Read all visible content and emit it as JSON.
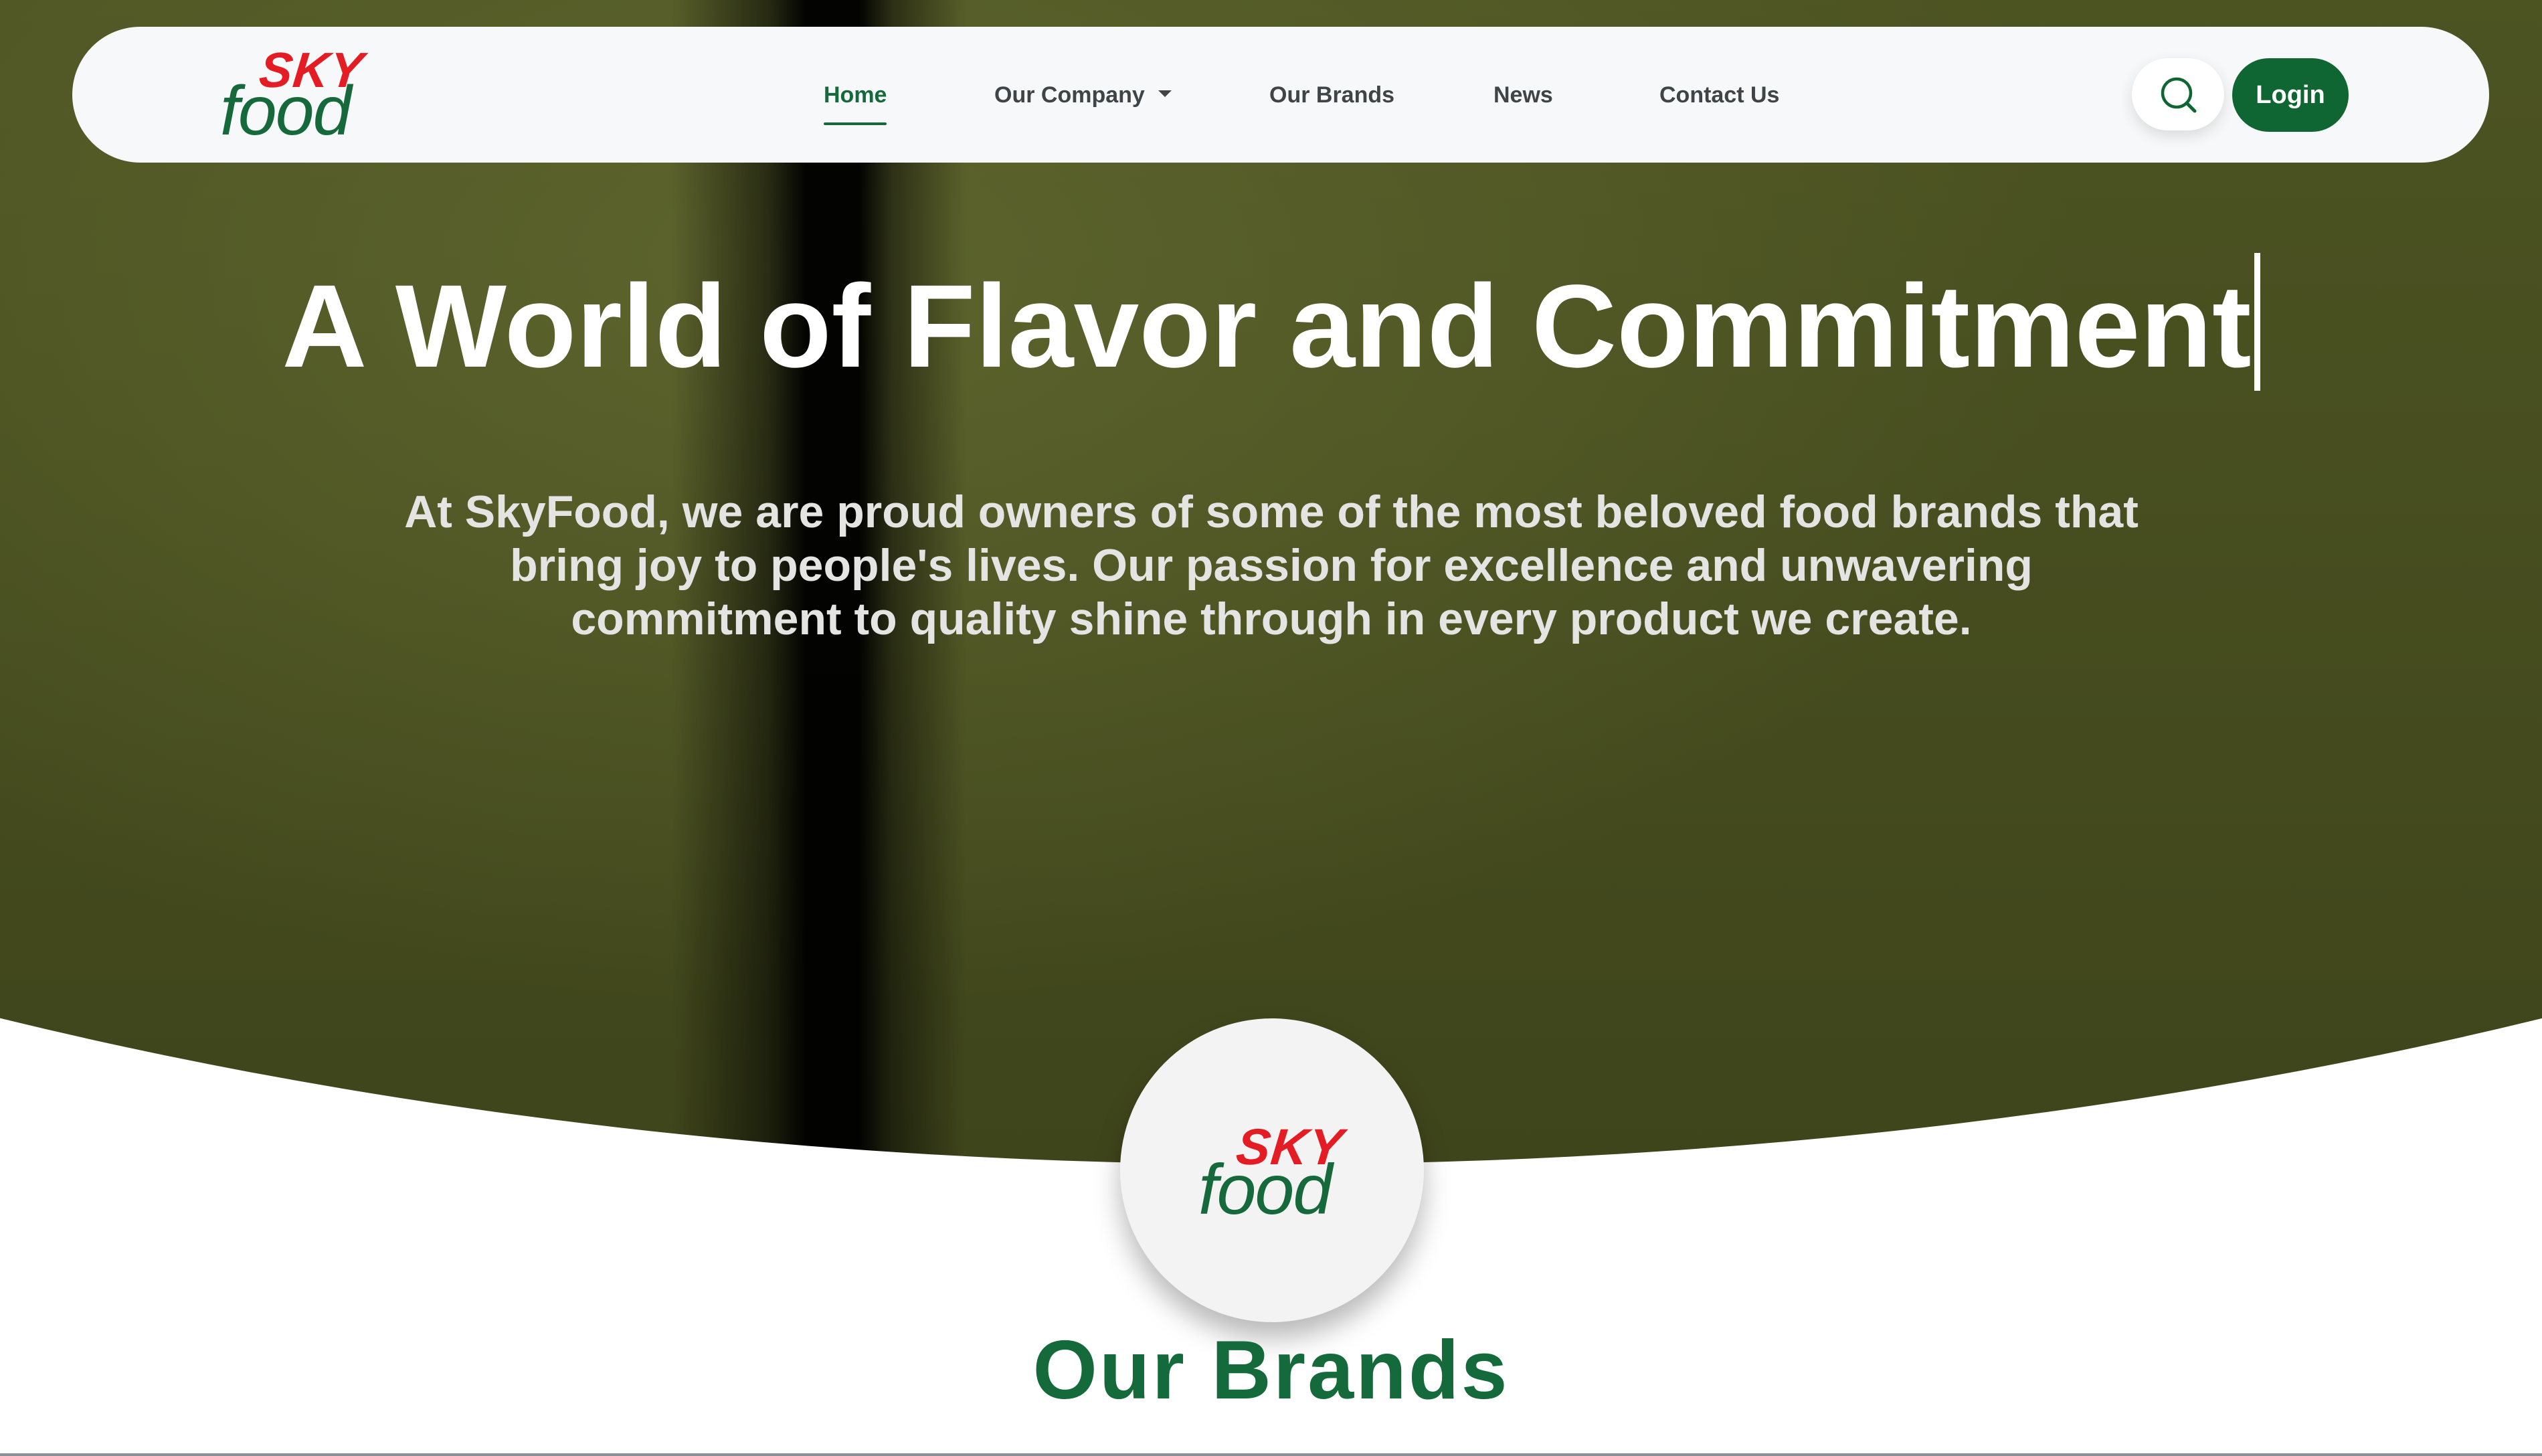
{
  "brand": {
    "logo_top": "SKY",
    "logo_bottom": "food"
  },
  "nav": {
    "items": [
      {
        "label": "Home",
        "active": true
      },
      {
        "label": "Our Company",
        "has_dropdown": true
      },
      {
        "label": "Our Brands"
      },
      {
        "label": "News"
      },
      {
        "label": "Contact Us"
      }
    ],
    "search_icon": "search-icon",
    "login_label": "Login"
  },
  "hero": {
    "title": "A World of Flavor and Commitment",
    "subtitle": "At SkyFood, we are proud owners of some of the most beloved food brands that bring joy to people's lives. Our passion for excellence and unwavering commitment to quality shine through in every product we create."
  },
  "section": {
    "title": "Our Brands"
  },
  "colors": {
    "primary_green": "#0f6633",
    "logo_red": "#e41c24",
    "hero_olive": "#4c5322",
    "nav_background": "#f6f8fa"
  }
}
